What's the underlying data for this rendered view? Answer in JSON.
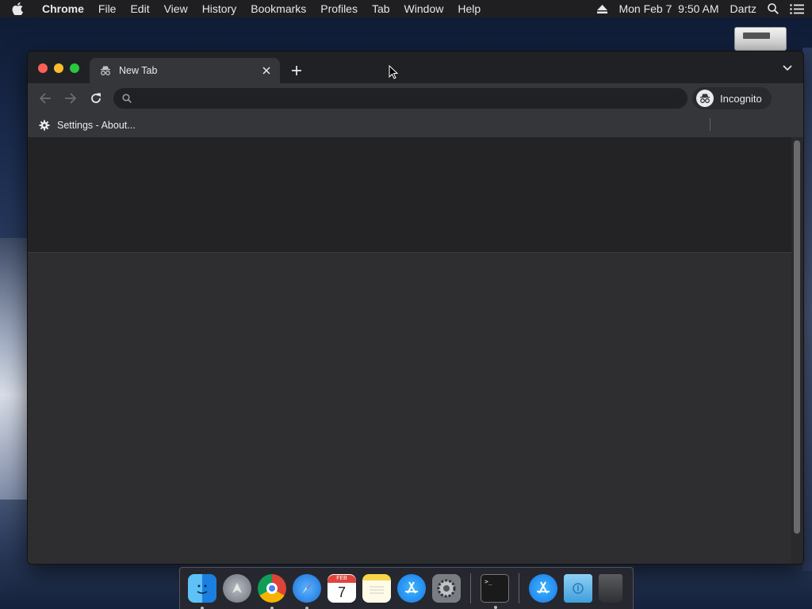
{
  "menubar": {
    "app": "Chrome",
    "items": [
      "File",
      "Edit",
      "View",
      "History",
      "Bookmarks",
      "Profiles",
      "Tab",
      "Window",
      "Help"
    ],
    "datetime": "Mon Feb 7  9:50 AM",
    "user": "Dartz"
  },
  "tab": {
    "title": "New Tab"
  },
  "omnibox": {
    "value": "",
    "placeholder": ""
  },
  "profile": {
    "label": "Incognito"
  },
  "bookmarks": {
    "items": [
      {
        "label": "Settings - About..."
      }
    ]
  },
  "dock": {
    "items": [
      "finder-icon",
      "launchpad-icon",
      "chrome-icon",
      "safari-icon",
      "calendar-icon",
      "notes-icon",
      "app-store-icon",
      "system-preferences-icon",
      "terminal-icon",
      "app-store-folder-icon",
      "downloads-folder-icon",
      "trash-icon"
    ],
    "calendar": {
      "month": "FEB",
      "day": "7"
    }
  },
  "colors": {
    "close": "#fe5f57",
    "minimize": "#febc2e",
    "maximize": "#28c840"
  }
}
